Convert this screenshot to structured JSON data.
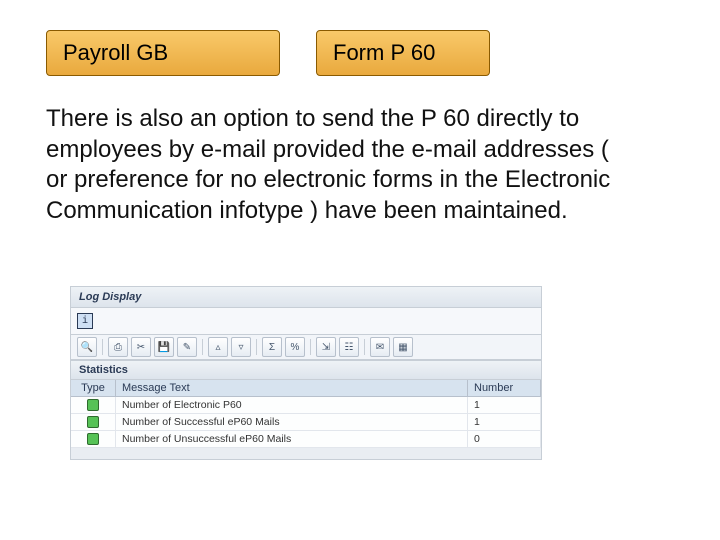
{
  "header": {
    "left_label": "Payroll GB",
    "right_label": "Form P 60"
  },
  "body_text": "There is also an option to send the P 60 directly to employees by e-mail provided the e-mail addresses ( or preference for no electronic forms in the Electronic Communication infotype ) have been maintained.",
  "sap_panel": {
    "title": "Log Display",
    "info_icon_glyph": "i",
    "toolbar_icons": [
      "search-icon",
      "print-icon",
      "filter-icon",
      "save-icon",
      "edit-icon",
      "sort-asc-icon",
      "sort-desc-icon",
      "sum-icon",
      "percent-icon",
      "export-icon",
      "layout-icon",
      "mail-icon",
      "spreadsheet-icon"
    ],
    "section_title": "Statistics",
    "columns": {
      "type": "Type",
      "message": "Message Text",
      "number": "Number"
    },
    "rows": [
      {
        "status": "success",
        "message": "Number of Electronic P60",
        "number": "1"
      },
      {
        "status": "success",
        "message": "Number of Successful eP60 Mails",
        "number": "1"
      },
      {
        "status": "success",
        "message": "Number of Unsuccessful eP60 Mails",
        "number": "0"
      }
    ]
  }
}
